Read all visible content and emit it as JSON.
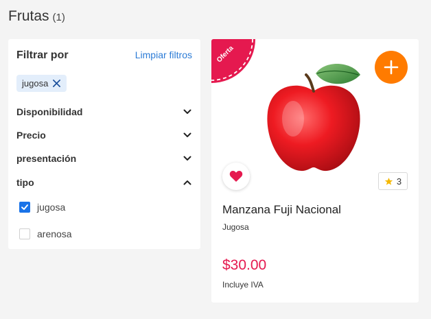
{
  "header": {
    "title": "Frutas",
    "count": "(1)"
  },
  "filters": {
    "title": "Filtrar por",
    "clear_label": "Limpiar filtros",
    "active_chip": "jugosa",
    "facets": [
      {
        "label": "Disponibilidad",
        "expanded": false
      },
      {
        "label": "Precio",
        "expanded": false
      },
      {
        "label": "presentación",
        "expanded": false
      },
      {
        "label": "tipo",
        "expanded": true
      }
    ],
    "options": [
      {
        "label": "jugosa",
        "checked": true
      },
      {
        "label": "arenosa",
        "checked": false
      }
    ]
  },
  "product": {
    "badge": "Oferta",
    "name": "Manzana Fuji Nacional",
    "subtitle": "Jugosa",
    "rating": "3",
    "price": "$30.00",
    "tax_note": "Incluye IVA"
  },
  "colors": {
    "accent_orange": "#ff7b00",
    "price_red": "#e5194f",
    "link_blue": "#2b7bd6",
    "checkbox_blue": "#1a73e8"
  },
  "icons": [
    "close-icon",
    "chevron-down-icon",
    "chevron-up-icon",
    "check-icon",
    "plus-icon",
    "heart-icon",
    "star-icon"
  ]
}
